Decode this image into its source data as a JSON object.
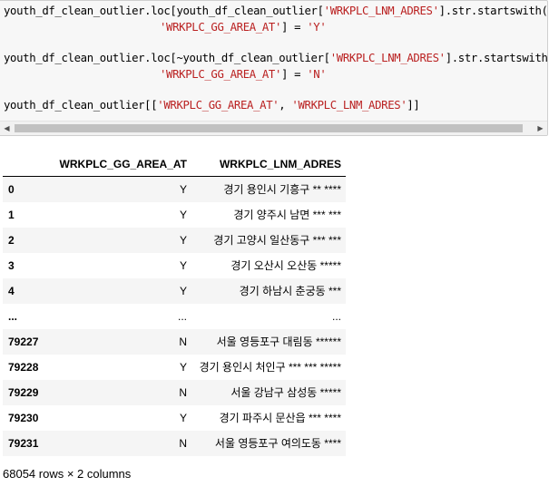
{
  "code": {
    "line1_a": "youth_df_clean_outlier.loc[youth_df_clean_outlier[",
    "line1_str": "'WRKPLC_LNM_ADRES'",
    "line1_b": "].str.startswith(",
    "line1_c": "'",
    "line2_str": "'WRKPLC_GG_AREA_AT'",
    "line2_b": "] = ",
    "line2_val": "'Y'",
    "line3_a": "youth_df_clean_outlier.loc[~youth_df_clean_outlier[",
    "line3_str": "'WRKPLC_LNM_ADRES'",
    "line3_b": "].str.startswith(",
    "line4_str": "'WRKPLC_GG_AREA_AT'",
    "line4_b": "] = ",
    "line4_val": "'N'",
    "line5_a": "youth_df_clean_outlier[[",
    "line5_str1": "'WRKPLC_GG_AREA_AT'",
    "line5_sep": ", ",
    "line5_str2": "'WRKPLC_LNM_ADRES'",
    "line5_b": "]]"
  },
  "scrollbar": {
    "left_arrow": "◀",
    "right_arrow": "▶"
  },
  "table": {
    "columns": [
      "",
      "WRKPLC_GG_AREA_AT",
      "WRKPLC_LNM_ADRES"
    ],
    "rows": [
      {
        "index": "0",
        "area": "Y",
        "addr": "경기 용인시 기흥구 ** ****"
      },
      {
        "index": "1",
        "area": "Y",
        "addr": "경기 양주시 남면 *** ***"
      },
      {
        "index": "2",
        "area": "Y",
        "addr": "경기 고양시 일산동구 *** ***"
      },
      {
        "index": "3",
        "area": "Y",
        "addr": "경기 오산시 오산동 *****"
      },
      {
        "index": "4",
        "area": "Y",
        "addr": "경기 하남시 춘궁동 ***"
      },
      {
        "index": "...",
        "area": "...",
        "addr": "..."
      },
      {
        "index": "79227",
        "area": "N",
        "addr": "서울 영등포구 대림동 ******"
      },
      {
        "index": "79228",
        "area": "Y",
        "addr": "경기 용인시 처인구 *** *** *****"
      },
      {
        "index": "79229",
        "area": "N",
        "addr": "서울 강남구 삼성동 *****"
      },
      {
        "index": "79230",
        "area": "Y",
        "addr": "경기 파주시 문산읍 *** ****"
      },
      {
        "index": "79231",
        "area": "N",
        "addr": "서울 영등포구 여의도동 ****"
      }
    ]
  },
  "footer": "68054 rows × 2 columns"
}
